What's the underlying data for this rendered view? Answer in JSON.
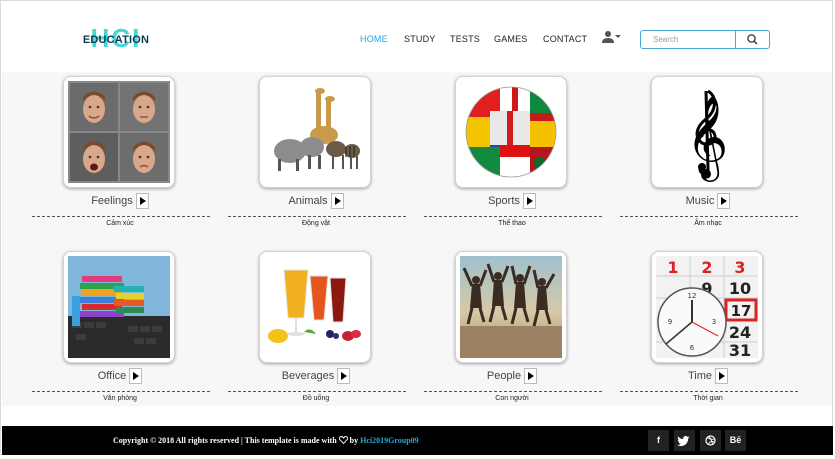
{
  "brand": {
    "logo_big": "HCI",
    "logo_text": "EDUCATION"
  },
  "nav": [
    {
      "label": "HOME",
      "active": true
    },
    {
      "label": "STUDY",
      "active": false
    },
    {
      "label": "TESTS",
      "active": false
    },
    {
      "label": "GAMES",
      "active": false
    },
    {
      "label": "CONTACT",
      "active": false
    }
  ],
  "search": {
    "placeholder": "Search"
  },
  "categories": [
    {
      "title": "Feelings",
      "subtitle": "Cảm xúc",
      "icon": "faces-image"
    },
    {
      "title": "Animals",
      "subtitle": "Động vật",
      "icon": "animals-image"
    },
    {
      "title": "Sports",
      "subtitle": "Thể thao",
      "icon": "flag-ball-image"
    },
    {
      "title": "Music",
      "subtitle": "Âm nhạc",
      "icon": "treble-clef-image"
    },
    {
      "title": "Office",
      "subtitle": "Văn phòng",
      "icon": "office-books-image"
    },
    {
      "title": "Beverages",
      "subtitle": "Đồ uống",
      "icon": "drinks-image"
    },
    {
      "title": "People",
      "subtitle": "Con người",
      "icon": "people-jumping-image"
    },
    {
      "title": "Time",
      "subtitle": "Thời gian",
      "icon": "calendar-clock-image"
    }
  ],
  "footer": {
    "copyright": "Copyright © 2018 All rights reserved | This template is made with",
    "by": "by",
    "author": "Hci2019Group09",
    "social": [
      "f",
      "t",
      "d",
      "Bē"
    ]
  },
  "colors": {
    "accent": "#27a7dc",
    "logo": "#2fd3d4",
    "footer_bg": "#000000"
  }
}
